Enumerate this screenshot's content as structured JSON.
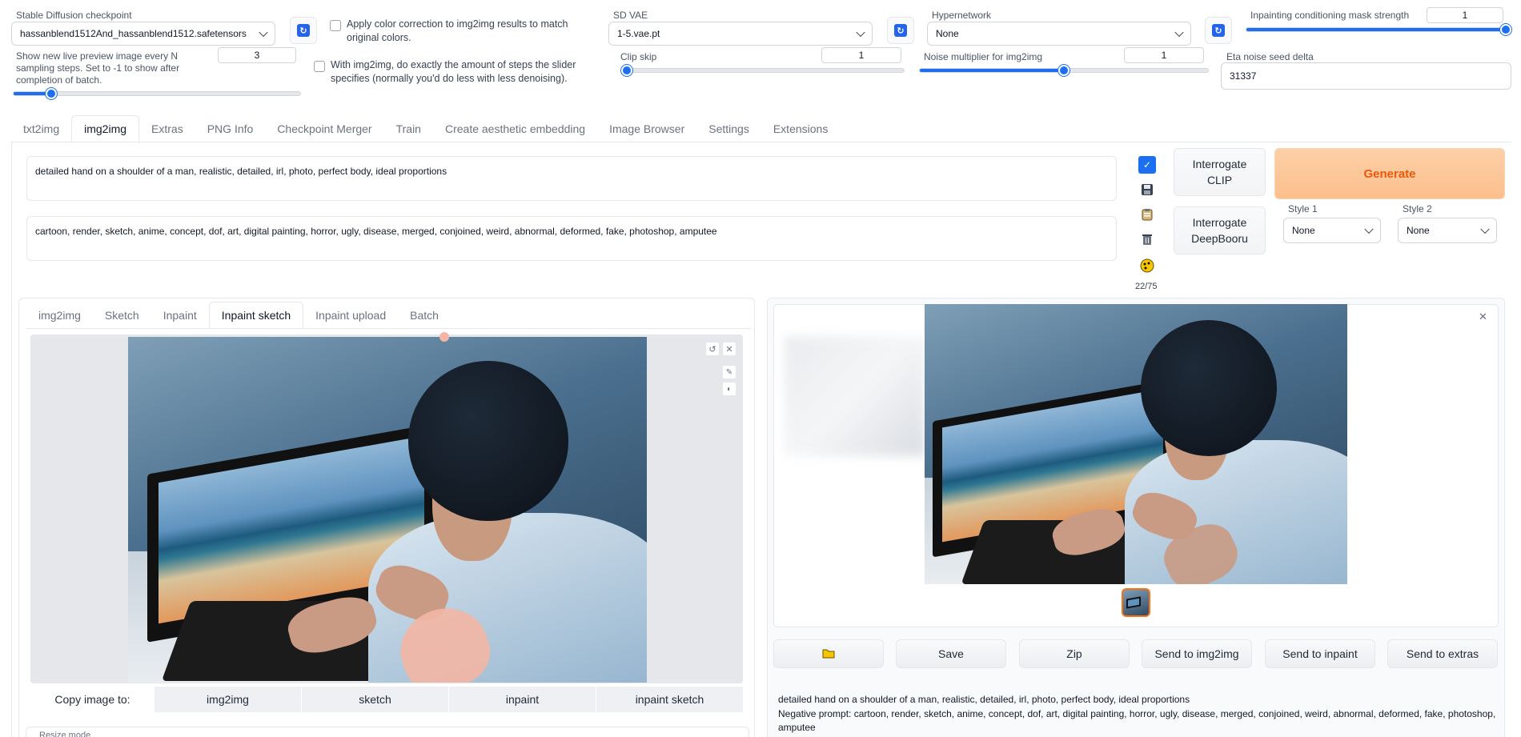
{
  "settings": {
    "checkpoint_label": "Stable Diffusion checkpoint",
    "checkpoint_value": "hassanblend1512And_hassanblend1512.safetensors",
    "color_correction_label": "Apply color correction to img2img results to match original colors.",
    "sd_vae_label": "SD VAE",
    "sd_vae_value": "1-5.vae.pt",
    "hypernetwork_label": "Hypernetwork",
    "hypernetwork_value": "None",
    "mask_strength_label": "Inpainting conditioning mask strength",
    "mask_strength_value": "1",
    "mask_strength_fraction": 1.0,
    "live_preview_label": "Show new live preview image every N sampling steps. Set to -1 to show after completion of batch.",
    "live_preview_value": "3",
    "live_preview_fraction": 0.13,
    "exact_steps_label": "With img2img, do exactly the amount of steps the slider specifies (normally you'd do less with less denoising).",
    "clip_skip_label": "Clip skip",
    "clip_skip_value": "1",
    "clip_skip_fraction": 0.0,
    "noise_mult_label": "Noise multiplier for img2img",
    "noise_mult_value": "1",
    "noise_mult_fraction": 0.5,
    "eta_label": "Eta noise seed delta",
    "eta_value": "31337"
  },
  "main_tabs": [
    "txt2img",
    "img2img",
    "Extras",
    "PNG Info",
    "Checkpoint Merger",
    "Train",
    "Create aesthetic embedding",
    "Image Browser",
    "Settings",
    "Extensions"
  ],
  "prompt": "detailed hand on a shoulder of a man, realistic, detailed, irl, photo, perfect body, ideal proportions",
  "negative_prompt": "cartoon, render, sketch, anime, concept, dof, art, digital painting, horror, ugly, disease, merged, conjoined, weird, abnormal, deformed, fake, photoshop, amputee",
  "token_count": "22/75",
  "buttons": {
    "interrogate_clip": "Interrogate CLIP",
    "interrogate_deepbooru": "Interrogate DeepBooru",
    "generate": "Generate"
  },
  "styles": {
    "style1_label": "Style 1",
    "style1_value": "None",
    "style2_label": "Style 2",
    "style2_value": "None"
  },
  "sub_tabs": [
    "img2img",
    "Sketch",
    "Inpaint",
    "Inpaint sketch",
    "Inpaint upload",
    "Batch"
  ],
  "copy_image": {
    "label": "Copy image to:",
    "targets": [
      "img2img",
      "sketch",
      "inpaint",
      "inpaint sketch"
    ]
  },
  "resize_mode_label": "Resize mode",
  "output_buttons": [
    "Save",
    "Zip",
    "Send to img2img",
    "Send to inpaint",
    "Send to extras"
  ],
  "output_info": {
    "prompt": "detailed hand on a shoulder of a man, realistic, detailed, irl, photo, perfect body, ideal proportions",
    "negative": "Negative prompt: cartoon, render, sketch, anime, concept, dof, art, digital painting, horror, ugly, disease, merged, conjoined, weird, abnormal, deformed, fake, photoshop, amputee"
  },
  "colors": {
    "accent": "#1d6ff2",
    "generate_bg": "#fdc99a",
    "generate_text": "#ea580c"
  }
}
